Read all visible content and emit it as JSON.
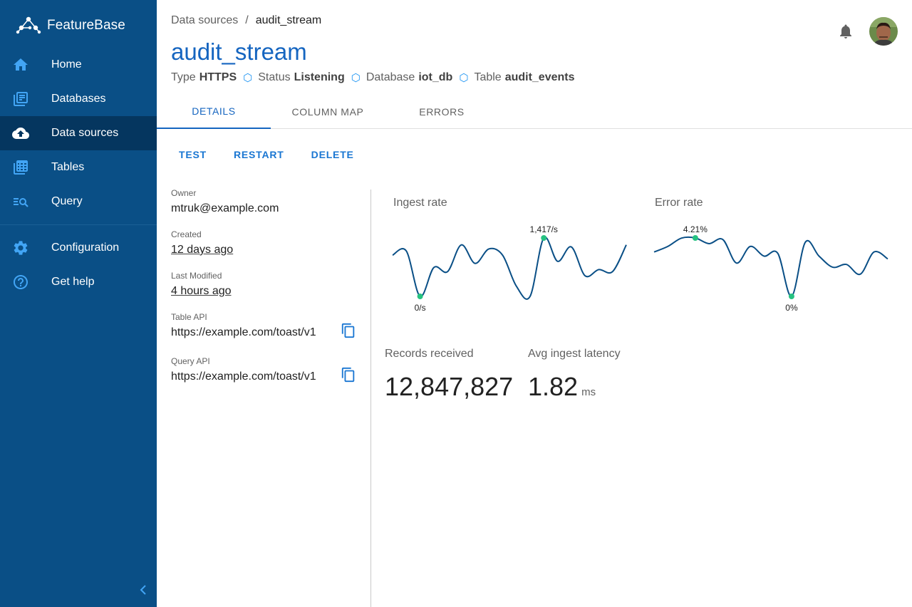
{
  "brand": {
    "name": "FeatureBase"
  },
  "sidebar": {
    "items": [
      {
        "label": "Home",
        "icon": "home-icon"
      },
      {
        "label": "Databases",
        "icon": "databases-icon"
      },
      {
        "label": "Data sources",
        "icon": "cloud-upload-icon",
        "active": true
      },
      {
        "label": "Tables",
        "icon": "table-icon"
      },
      {
        "label": "Query",
        "icon": "query-icon"
      }
    ],
    "secondary": [
      {
        "label": "Configuration",
        "icon": "gear-icon"
      },
      {
        "label": "Get help",
        "icon": "help-icon"
      }
    ],
    "collapse_icon": "chevron-left-icon"
  },
  "header": {
    "breadcrumb": {
      "parent": "Data sources",
      "separator": "/",
      "current": "audit_stream"
    },
    "title": "audit_stream",
    "meta": [
      {
        "label": "Type",
        "value": "HTTPS"
      },
      {
        "label": "Status",
        "value": "Listening"
      },
      {
        "label": "Database",
        "value": "iot_db"
      },
      {
        "label": "Table",
        "value": "audit_events"
      }
    ],
    "meta_separator": "⬡"
  },
  "tabs": [
    {
      "label": "DETAILS",
      "active": true
    },
    {
      "label": "COLUMN MAP"
    },
    {
      "label": "ERRORS"
    }
  ],
  "actions": {
    "test": "TEST",
    "restart": "RESTART",
    "delete": "DELETE"
  },
  "details": {
    "owner": {
      "label": "Owner",
      "value": "mtruk@example.com"
    },
    "created": {
      "label": "Created",
      "value": "12 days ago"
    },
    "modified": {
      "label": "Last Modified",
      "value": "4 hours ago"
    },
    "table_api": {
      "label": "Table API",
      "value": "https://example.com/toast/v1"
    },
    "query_api": {
      "label": "Query API",
      "value": "https://example.com/toast/v1"
    }
  },
  "chart_data": [
    {
      "type": "line",
      "title": "Ingest rate",
      "unit": "/s",
      "values": [
        1000,
        1100,
        0,
        700,
        600,
        1250,
        800,
        1150,
        1000,
        250,
        0,
        1417,
        850,
        1200,
        500,
        650,
        600,
        1250
      ],
      "min_label": "0/s",
      "max_label": "1,417/s",
      "color": "#0a4f86",
      "highlight_color": "#26c281"
    },
    {
      "type": "line",
      "title": "Error rate",
      "unit": "%",
      "values": [
        3.2,
        3.6,
        4.2,
        4.21,
        3.8,
        4.1,
        2.4,
        3.6,
        2.9,
        3.1,
        0,
        3.9,
        2.9,
        2.1,
        2.3,
        1.6,
        3.2,
        2.7
      ],
      "min_label": "0%",
      "max_label": "4.21%",
      "color": "#0a4f86",
      "highlight_color": "#26c281"
    }
  ],
  "stats": {
    "records": {
      "label": "Records received",
      "value": "12,847,827"
    },
    "latency": {
      "label": "Avg ingest latency",
      "value": "1.82",
      "unit": "ms"
    }
  },
  "colors": {
    "sidebar": "#0a4f86",
    "sidebar_active": "#05365f",
    "accent": "#1565c0",
    "sparkline": "#0a4f86",
    "highlight": "#26c281"
  }
}
